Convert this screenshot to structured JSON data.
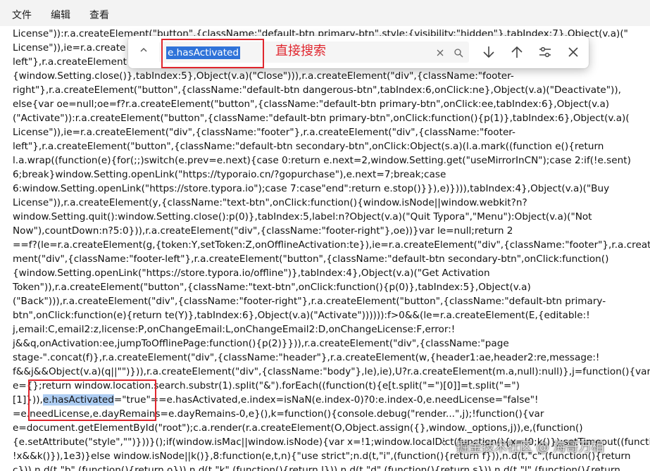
{
  "menu": {
    "file": "文件",
    "edit": "编辑",
    "view": "查看"
  },
  "find_bar": {
    "query": "e.hasActivated",
    "annotation": "直接搜索",
    "icons": {
      "collapse": "chevron-up-icon",
      "clear": "close-icon",
      "search": "search-icon",
      "next": "arrow-down-icon",
      "previous": "arrow-up-icon",
      "options": "sliders-icon",
      "close": "close-icon"
    }
  },
  "code": {
    "lines": [
      {
        "text": "License\")):r.a.createElement(\"button\",{className:\"default-btn primary-btn\",style:{visibility:\"hidden\"},tabIndex:7},Object(v.a)(\""
      },
      {
        "text": "License\")),ie=r.a.create"
      },
      {
        "text": "left\"},r.a.createElement"
      },
      {
        "text": "{window.Setting.close()},tabIndex:5},Object(v.a)(\"Close\"))),r.a.createElement(\"div\",{className:\"footer-"
      },
      {
        "text": "right\"},r.a.createElement(\"button\",{className:\"default-btn dangerous-btn\",tabIndex:6,onClick:ne},Object(v.a)(\"Deactivate\")),"
      },
      {
        "text": "else{var oe=null;oe=f?r.a.createElement(\"button\",{className:\"default-btn primary-btn\",onClick:ee,tabIndex:6},Object(v.a)"
      },
      {
        "text": "(\"Activate\")):r.a.createElement(\"button\",{className:\"default-btn primary-btn\",onClick:function(){p(1)},tabIndex:6},Object(v.a)("
      },
      {
        "text": "License\")),ie=r.a.createElement(\"div\",{className:\"footer\"},r.a.createElement(\"div\",{className:\"footer-"
      },
      {
        "text": "left\"},r.a.createElement(\"button\",{className:\"default-btn secondary-btn\",onClick:Object(s.a)(l.a.mark((function e(){return"
      },
      {
        "text": "l.a.wrap((function(e){for(;;)switch(e.prev=e.next){case 0:return e.next=2,window.Setting.get(\"useMirrorInCN\");case 2:if(!e.sent)"
      },
      {
        "text": "6;break}window.Setting.openLink(\"https://typoraio.cn/?gopurchase\"),e.next=7;break;case"
      },
      {
        "text": "6:window.Setting.openLink(\"https://store.typora.io\");case 7:case\"end\":return e.stop()}}),e)}))),tabIndex:4},Object(v.a)(\"Buy"
      },
      {
        "text": "License\")),r.a.createElement(y,{className:\"text-btn\",onClick:function(){window.isNode||window.webkit?n?"
      },
      {
        "text": "window.Setting.quit():window.Setting.close():p(0)},tabIndex:5,label:n?Object(v.a)(\"Quit Typora\",\"Menu\"):Object(v.a)(\"Not"
      },
      {
        "text": "Now\"),countDown:n?5:0})),r.a.createElement(\"div\",{className:\"footer-right\"},oe))}var le=null;return 2"
      },
      {
        "text": "==f?(le=r.a.createElement(g,{token:Y,setToken:Z,onOfflineActivation:te}),ie=r.a.createElement(\"div\",{className:\"footer\"},r.a.create"
      },
      {
        "text": "ment(\"div\",{className:\"footer-left\"},r.a.createElement(\"button\",{className:\"default-btn secondary-btn\",onClick:function()"
      },
      {
        "text": "{window.Setting.openLink(\"https://store.typora.io/offline\")},tabIndex:4},Object(v.a)(\"Get Activation"
      },
      {
        "text": "Token\")),r.a.createElement(\"button\",{className:\"text-btn\",onClick:function(){p(0)},tabIndex:5},Object(v.a)"
      },
      {
        "text": "(\"Back\"))),r.a.createElement(\"div\",{className:\"footer-right\"},r.a.createElement(\"button\",{className:\"default-btn primary-"
      },
      {
        "text": "btn\",onClick:function(e){return te(Y)},tabIndex:6},Object(v.a)(\"Activate\")))))):f>0&&(le=r.a.createElement(E,{editable:!"
      },
      {
        "text": "j,email:C,email2:z,license:P,onChangeEmail:L,onChangeEmail2:D,onChangeLicense:F,error:!"
      },
      {
        "text": "j&&q,onActivation:ee,jumpToOfflinePage:function(){p(2)}})),r.a.createElement(\"div\",{className:\"page"
      },
      {
        "text": "stage-\".concat(f)},r.a.createElement(\"div\",{className:\"header\"},r.a.createElement(w,{header1:ae,header2:re,message:!"
      },
      {
        "text": "f&&j&&Object(v.a)(q||\"\")})),r.a.createElement(\"div\",{className:\"body\"},le),ie),U?r.a.createElement(m.a,null):null)},j=function(){var"
      },
      {
        "text": "e={};return window.location.search.substr(1).split(\"&\").forEach((function(t){e[t.split(\"=\")[0]]=t.split(\"=\")"
      },
      {
        "pre": "[1]})),",
        "highlight": "e.hasActivated",
        "post": "=\"true\"==e.hasActivated,e.index=isNaN(e.index-0)?0:e.index-0,e.needLicense=\"false\"!"
      },
      {
        "text": "=e.needLicense,e.dayRemains=e.dayRemains-0,e}(),k=function(){console.debug(\"render...\",j);!function(){var"
      },
      {
        "text": "e=document.getElementById(\"root\");c.a.render(r.a.createElement(O,Object.assign({},window._options,j)),e,(function()"
      },
      {
        "text": "{e.setAttribute(\"style\",\"\")}))}();if(window.isMac||window.isNode){var x=!1;window.localDict(function(){x=!0;k()});setTimeout((function(){"
      },
      {
        "text": "!x&&k()}),1e3)}else window.isNode||k()},8:function(e,t,n){\"use strict\";n.d(t,\"i\",(function(){return f})),n.d(t,\"c\",(function(){return"
      },
      {
        "text": "c})),n.d(t,\"b\",(function(){return o})),n.d(t,\"k\",(function(){return l})),n.d(t,\"d\",(function(){return s})),n.d(t,\"l\",(function(){return"
      }
    ]
  },
  "watermark": {
    "text": "掘金技术社区 @ 海哥万相",
    "icon": "juejin-logo-icon"
  }
}
